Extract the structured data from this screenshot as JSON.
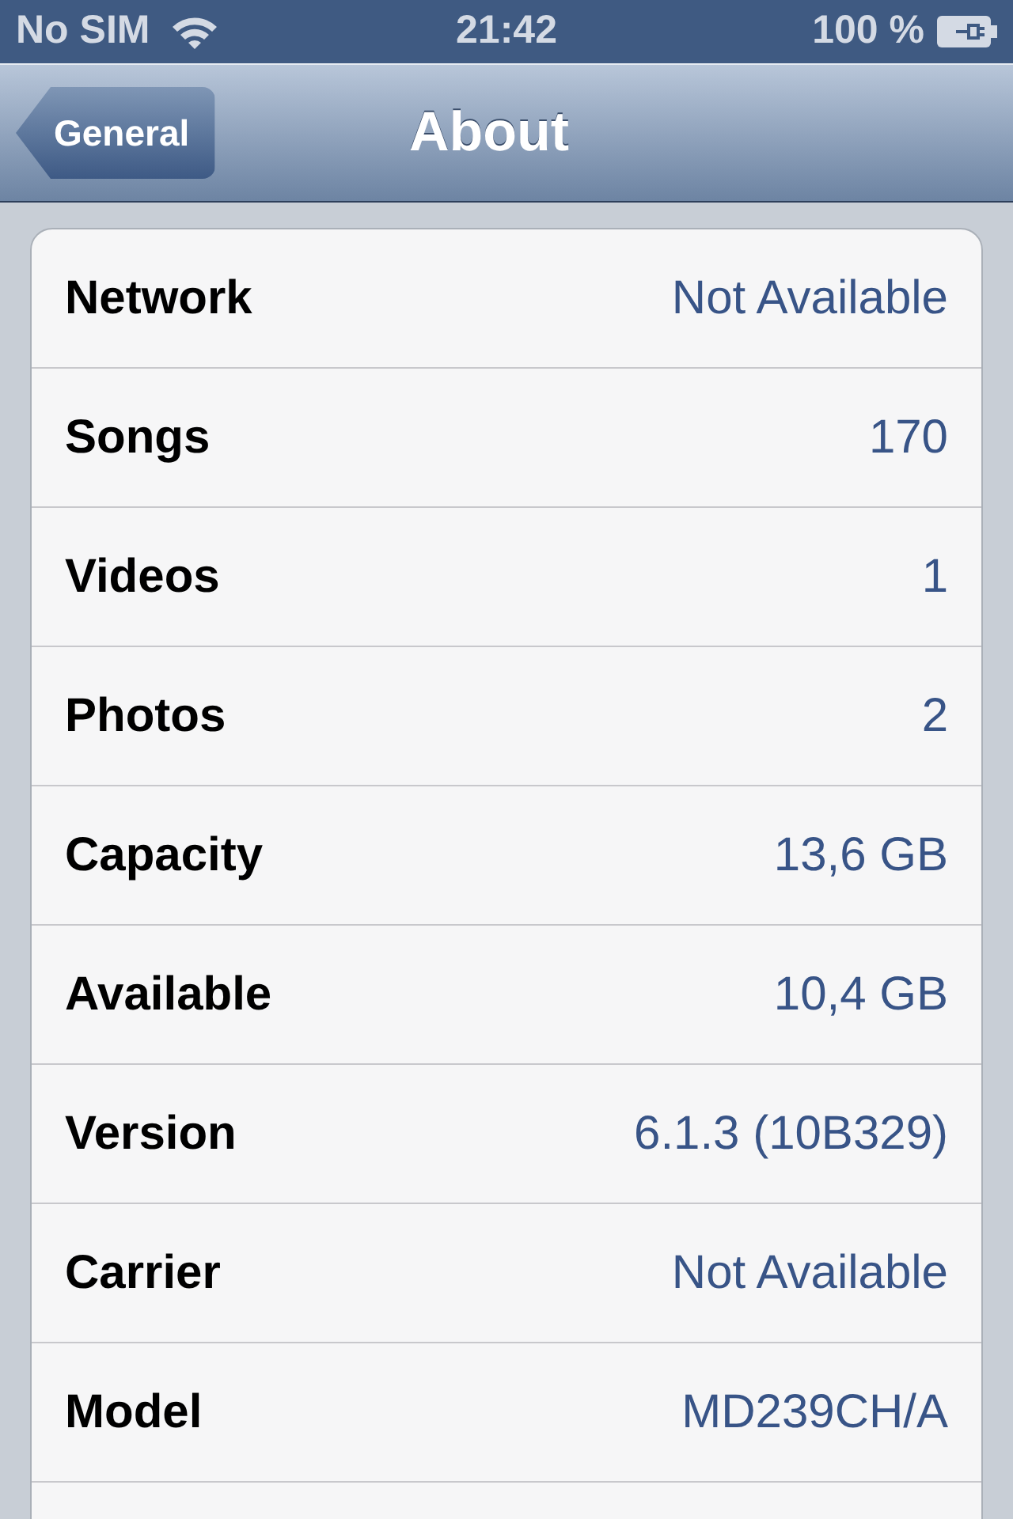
{
  "status_bar": {
    "carrier": "No SIM",
    "time": "21:42",
    "battery": "100 %"
  },
  "nav_bar": {
    "back": "General",
    "title": "About"
  },
  "rows": [
    {
      "label": "Network",
      "value": "Not Available"
    },
    {
      "label": "Songs",
      "value": "170"
    },
    {
      "label": "Videos",
      "value": "1"
    },
    {
      "label": "Photos",
      "value": "2"
    },
    {
      "label": "Capacity",
      "value": "13,6 GB"
    },
    {
      "label": "Available",
      "value": "10,4 GB"
    },
    {
      "label": "Version",
      "value": "6.1.3 (10B329)"
    },
    {
      "label": "Carrier",
      "value": "Not Available"
    },
    {
      "label": "Model",
      "value": "MD239CH/A"
    }
  ]
}
